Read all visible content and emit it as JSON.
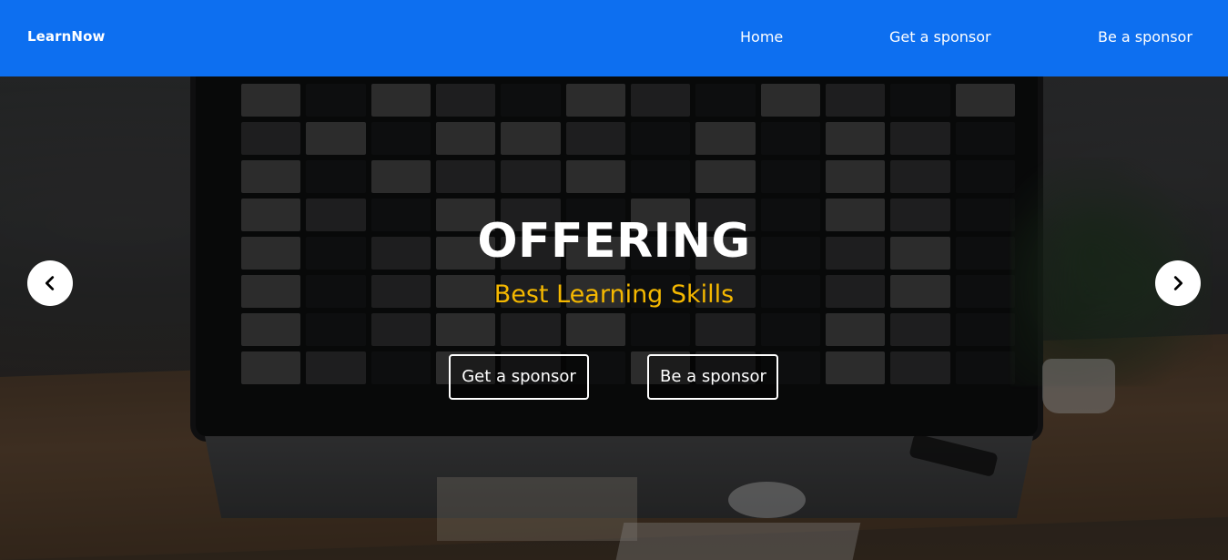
{
  "navbar": {
    "brand": "LearnNow",
    "links": [
      {
        "label": "Home"
      },
      {
        "label": "Get a sponsor"
      },
      {
        "label": "Be a sponsor"
      }
    ],
    "background_color": "#0d6ff0"
  },
  "hero": {
    "title": "OFFERING",
    "subtitle": "Best Learning Skills",
    "subtitle_color": "#f5b800",
    "buttons": [
      {
        "label": "Get a sponsor"
      },
      {
        "label": "Be a sponsor"
      }
    ],
    "carousel": {
      "prev_icon": "chevron-left-icon",
      "next_icon": "chevron-right-icon"
    },
    "background_image": "desk-workspace-photo"
  }
}
